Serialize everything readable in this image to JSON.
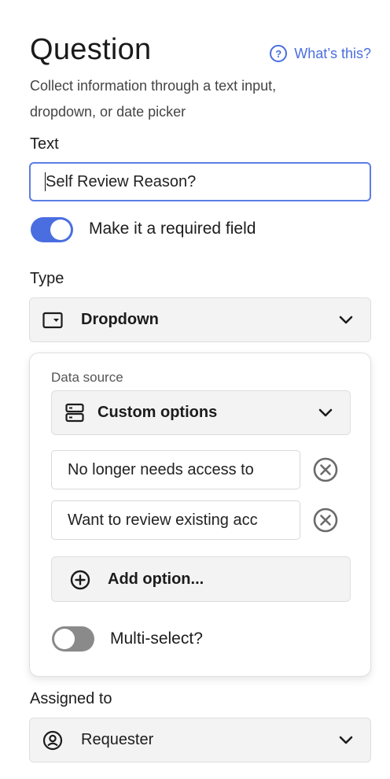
{
  "header": {
    "title": "Question",
    "help_link": "What’s this?",
    "help_icon_glyph": "?",
    "description": "Collect information through a text input, dropdown, or date picker"
  },
  "text_field": {
    "label": "Text",
    "value": "Self Review Reason?"
  },
  "required_toggle": {
    "label": "Make it a required field",
    "on": true
  },
  "type_field": {
    "label": "Type",
    "selected": "Dropdown",
    "icon": "dropdown-icon"
  },
  "data_source": {
    "label": "Data source",
    "selected": "Custom options",
    "icon": "server-icon",
    "options": [
      {
        "value": "No longer needs access to"
      },
      {
        "value": "Want to review existing acc"
      }
    ],
    "add_option_label": "Add option...",
    "multi_select": {
      "label": "Multi-select?",
      "on": false
    }
  },
  "assigned_to": {
    "label": "Assigned to",
    "selected": "Requester",
    "icon": "user-circle-icon"
  },
  "colors": {
    "accent": "#4a6ee0",
    "field_bg": "#f3f3f3",
    "toggle_off": "#8a8a8a"
  }
}
